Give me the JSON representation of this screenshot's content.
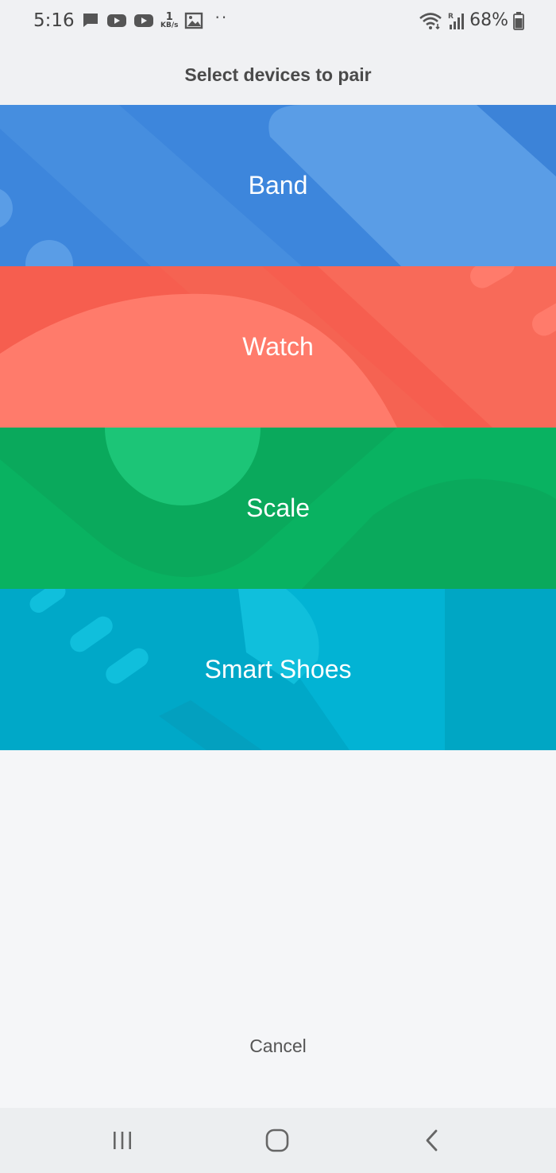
{
  "status_bar": {
    "time": "5:16",
    "net_speed_value": "1",
    "net_speed_unit": "KB/s",
    "battery_percent": "68%",
    "left_icons": [
      "message-icon",
      "youtube-icon",
      "youtube-icon",
      "image-icon"
    ],
    "right_icons": [
      "wifi-icon",
      "signal-icon",
      "battery-icon"
    ]
  },
  "header": {
    "title": "Select devices to pair"
  },
  "devices": [
    {
      "label": "Band",
      "color": "#3d86dc"
    },
    {
      "label": "Watch",
      "color": "#f65e4f"
    },
    {
      "label": "Scale",
      "color": "#09b261"
    },
    {
      "label": "Smart Shoes",
      "color": "#00a8c8"
    }
  ],
  "cancel_label": "Cancel",
  "nav_bar": {
    "buttons": [
      "recent-apps-icon",
      "home-icon",
      "back-icon"
    ]
  }
}
